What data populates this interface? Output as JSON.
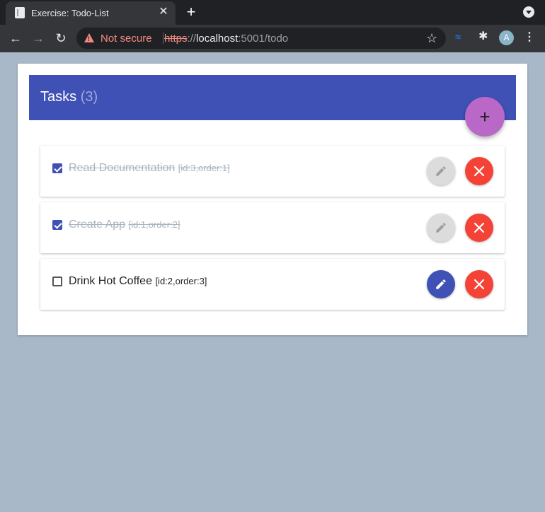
{
  "browser": {
    "tab_title": "Exercise: Todo-List",
    "tab_close": "✕",
    "new_tab": "+",
    "security_label": "Not secure",
    "url": {
      "scheme": "https",
      "separator": "://",
      "host": "localhost",
      "rest": ":5001/todo"
    },
    "avatar_letter": "A",
    "ext_label": "≈"
  },
  "header": {
    "title": "Tasks",
    "count": "(3)",
    "add_label": "+"
  },
  "tasks": [
    {
      "name": "Read Documentation",
      "meta": "[id:3,order:1]",
      "completed": true
    },
    {
      "name": "Create App",
      "meta": "[id:1,order:2]",
      "completed": true
    },
    {
      "name": "Drink Hot Coffee",
      "meta": "[id:2,order:3]",
      "completed": false
    }
  ],
  "colors": {
    "primary": "#3f51b5",
    "accent": "#ba68c8",
    "danger": "#f44336",
    "background": "#a8b8c8"
  }
}
